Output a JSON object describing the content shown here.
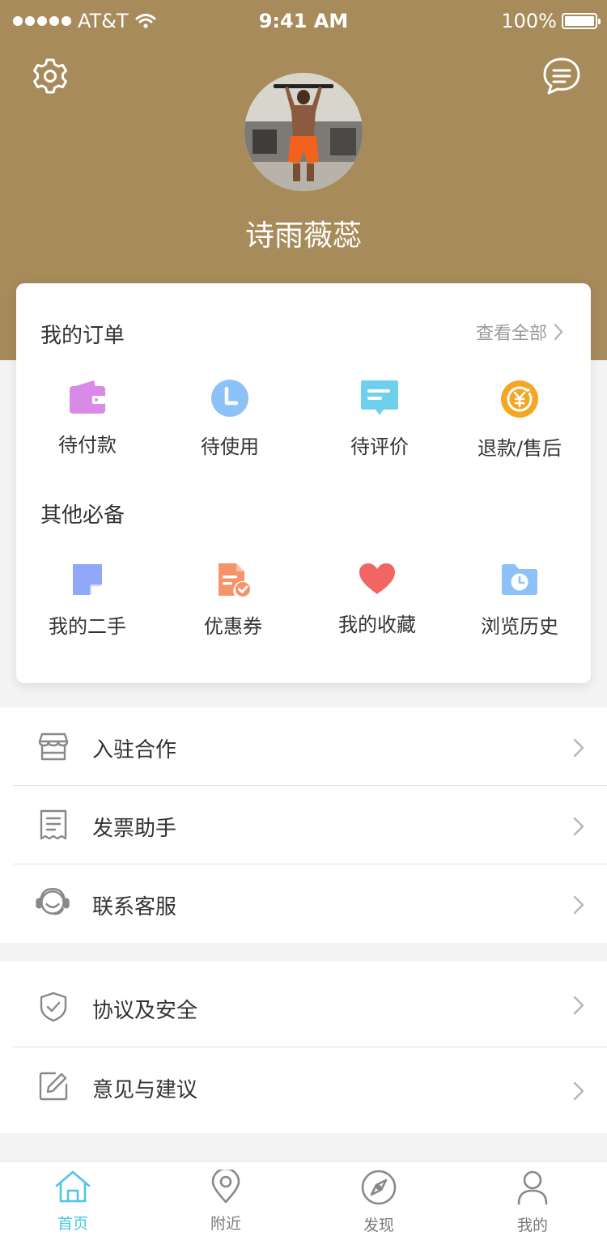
{
  "status_bar": {
    "carrier": "AT&T",
    "time": "9:41 AM",
    "battery": "100%"
  },
  "header": {
    "settings_icon": "gear-icon",
    "message_icon": "chat-bubble-icon",
    "username": "诗雨薇蕊",
    "background_color": "#a88b5b"
  },
  "orders": {
    "title": "我的订单",
    "view_all": "查看全部",
    "items": [
      {
        "label": "待付款",
        "icon": "wallet-icon",
        "color": "#d98ae6"
      },
      {
        "label": "待使用",
        "icon": "clock-icon",
        "color": "#8cc2f7"
      },
      {
        "label": "待评价",
        "icon": "comment-icon",
        "color": "#6fd0ee"
      },
      {
        "label": "退款/售后",
        "icon": "refund-yen-icon",
        "color": "#f5a623"
      }
    ]
  },
  "essentials": {
    "title": "其他必备",
    "items": [
      {
        "label": "我的二手",
        "icon": "note-icon",
        "color": "#8fa8f7"
      },
      {
        "label": "优惠券",
        "icon": "coupon-document-icon",
        "color": "#f7936b"
      },
      {
        "label": "我的收藏",
        "icon": "heart-icon",
        "color": "#f26565"
      },
      {
        "label": "浏览历史",
        "icon": "history-folder-icon",
        "color": "#8cc2f7"
      }
    ]
  },
  "menu_group_1": [
    {
      "label": "入驻合作",
      "icon": "store-icon"
    },
    {
      "label": "发票助手",
      "icon": "invoice-icon"
    },
    {
      "label": "联系客服",
      "icon": "headset-icon"
    }
  ],
  "menu_group_2": [
    {
      "label": "协议及安全",
      "icon": "shield-icon"
    },
    {
      "label": "意见与建议",
      "icon": "edit-icon"
    }
  ],
  "tabbar": {
    "active_color": "#4cc5e8",
    "items": [
      {
        "label": "首页",
        "icon": "home-icon"
      },
      {
        "label": "附近",
        "icon": "location-pin-icon"
      },
      {
        "label": "发现",
        "icon": "compass-icon"
      },
      {
        "label": "我的",
        "icon": "user-icon"
      }
    ]
  }
}
